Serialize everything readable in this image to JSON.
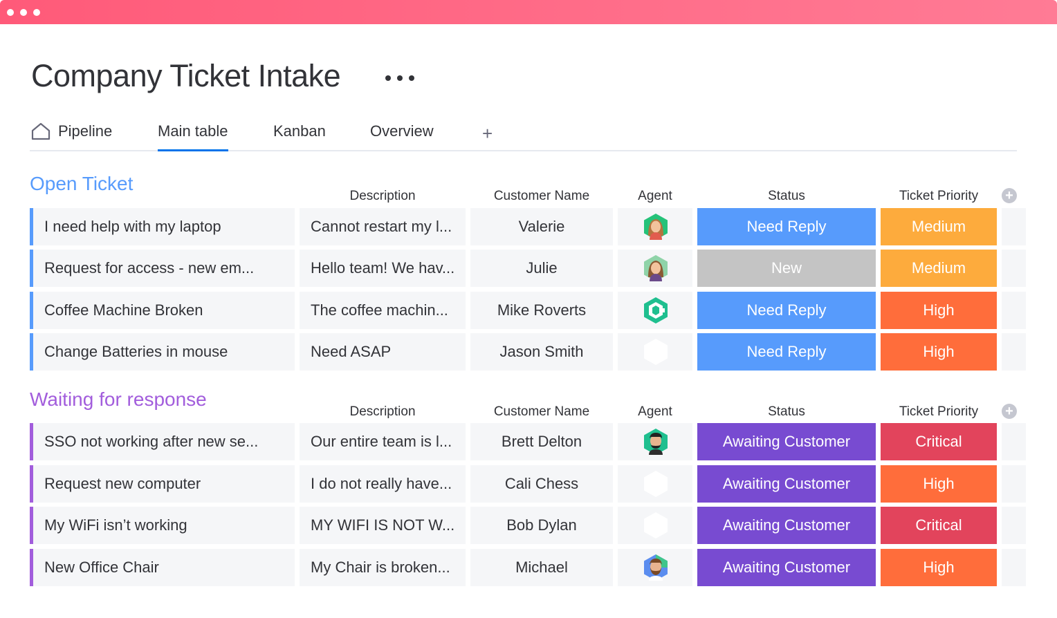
{
  "page": {
    "title": "Company Ticket Intake"
  },
  "tabs": [
    {
      "label": "Pipeline"
    },
    {
      "label": "Main table"
    },
    {
      "label": "Kanban"
    },
    {
      "label": "Overview"
    }
  ],
  "add_tab_label": "+",
  "colors": {
    "titlebar": "#ff6584",
    "open_group": "#579bfc",
    "waiting_group": "#a25ddc",
    "need_reply": "#579bfc",
    "new": "#c4c4c4",
    "awaiting_customer": "#784bd1",
    "medium": "#fdab3d",
    "high": "#ff6d3b",
    "critical": "#e2445c",
    "active_tab": "#0073ea"
  },
  "groups": [
    {
      "title": "Open Ticket",
      "headers": {
        "description": "Description",
        "customer": "Customer Name",
        "agent": "Agent",
        "status": "Status",
        "priority": "Ticket Priority"
      },
      "rows": [
        {
          "name": "I need help with my laptop",
          "description": "Cannot restart my l...",
          "customer": "Valerie",
          "agent": "woman-avatar-icon",
          "status": "Need Reply",
          "priority": "Medium"
        },
        {
          "name": "Request for access - new em...",
          "description": "Hello team! We hav...",
          "customer": "Julie",
          "agent": "woman-avatar-icon",
          "status": "New",
          "priority": "Medium"
        },
        {
          "name": "Coffee Machine Broken",
          "description": "The coffee machin...",
          "customer": "Mike Roverts",
          "agent": "logo-avatar-icon",
          "status": "Need Reply",
          "priority": "High"
        },
        {
          "name": "Change Batteries in mouse",
          "description": "Need ASAP",
          "customer": "Jason Smith",
          "agent": "empty-avatar-icon",
          "status": "Need Reply",
          "priority": "High"
        }
      ]
    },
    {
      "title": "Waiting for response",
      "headers": {
        "description": "Description",
        "customer": "Customer Name",
        "agent": "Agent",
        "status": "Status",
        "priority": "Ticket Priority"
      },
      "rows": [
        {
          "name": "SSO not working after new se...",
          "description": "Our entire team is l...",
          "customer": "Brett Delton",
          "agent": "man-avatar-icon",
          "status": "Awaiting Customer",
          "priority": "Critical"
        },
        {
          "name": "Request new computer",
          "description": "I do not really have...",
          "customer": "Cali Chess",
          "agent": "empty-avatar-icon",
          "status": "Awaiting Customer",
          "priority": "High"
        },
        {
          "name": "My WiFi isn’t working",
          "description": "MY WIFI IS NOT W...",
          "customer": "Bob Dylan",
          "agent": "empty-avatar-icon",
          "status": "Awaiting Customer",
          "priority": "Critical"
        },
        {
          "name": "New Office Chair",
          "description": "My Chair is broken...",
          "customer": "Michael",
          "agent": "bearded-man-avatar-icon",
          "status": "Awaiting Customer",
          "priority": "High"
        }
      ]
    }
  ]
}
